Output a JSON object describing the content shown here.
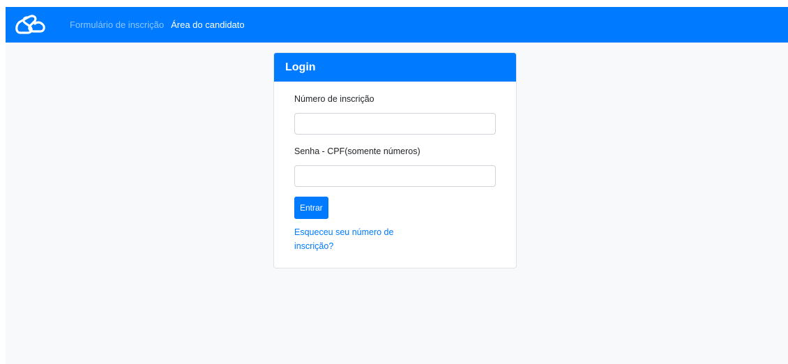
{
  "navbar": {
    "brand_icon": "logo-loop-icon",
    "links": [
      {
        "label": "Formulário de inscrição",
        "active": false
      },
      {
        "label": "Área do candidato",
        "active": true
      }
    ]
  },
  "login": {
    "title": "Login",
    "fields": [
      {
        "label": "Número de inscrição",
        "value": "",
        "placeholder": ""
      },
      {
        "label": "Senha - CPF(somente números)",
        "value": "",
        "placeholder": ""
      }
    ],
    "submit_label": "Entrar",
    "forgot_link": "Esqueceu seu número de inscrição?"
  },
  "colors": {
    "primary": "#007bff",
    "page_bg": "#f8f9fa",
    "text": "#212529"
  }
}
